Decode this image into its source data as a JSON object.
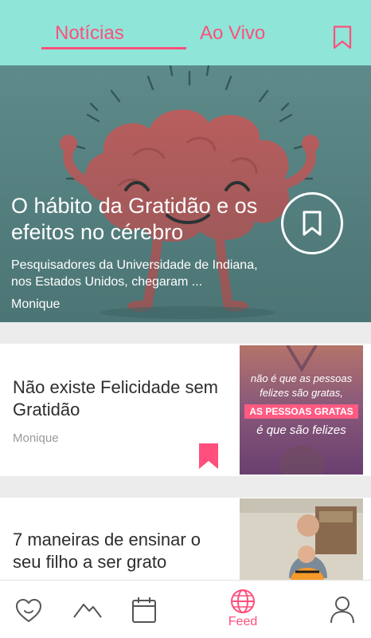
{
  "tabs": [
    {
      "label": "Notícias",
      "active": true
    },
    {
      "label": "Ao Vivo",
      "active": false
    }
  ],
  "hero": {
    "title": "O hábito da Gratidão e os efeitos no cérebro",
    "summary": "Pesquisadores da Universidade de Indiana, nos Estados Unidos, chegaram ...",
    "author": "Monique"
  },
  "cards": [
    {
      "title": "Não existe Felicidade sem Gratidão",
      "author": "Monique",
      "bookmarked": true,
      "thumb_lines": [
        "não é que as pessoas",
        "felizes são gratas,",
        "AS PESSOAS GRATAS",
        "é que são felizes"
      ]
    },
    {
      "title": "7 maneiras de ensinar o seu filho a ser grato",
      "author": ""
    }
  ],
  "bottom_nav": [
    {
      "icon": "heart-face-icon",
      "label": ""
    },
    {
      "icon": "mountain-icon",
      "label": ""
    },
    {
      "icon": "calendar-icon",
      "label": ""
    },
    {
      "icon": "globe-icon",
      "label": "Feed",
      "active": true
    },
    {
      "icon": "profile-icon",
      "label": ""
    }
  ],
  "colors": {
    "accent": "#ff4f7c",
    "topbar": "#8ee5d8",
    "hero_bg": "#5f8d8c"
  }
}
